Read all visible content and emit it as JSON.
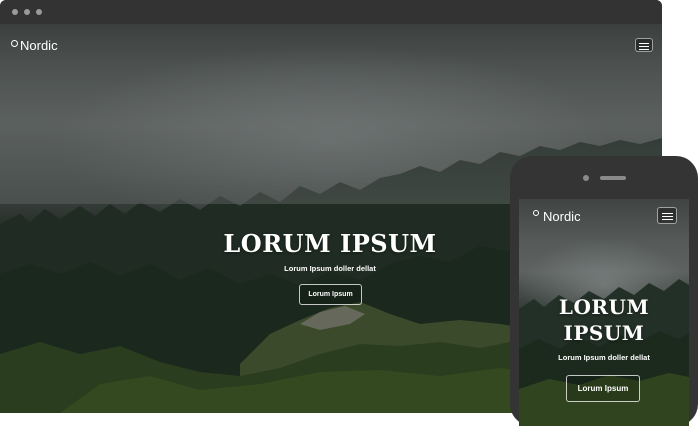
{
  "desktop": {
    "brand": "Nordic",
    "hero": {
      "title": "LORUM IPSUM",
      "subtitle": "Lorum Ipsum doller dellat",
      "button_label": "Lorum Ipsum"
    }
  },
  "mobile": {
    "brand": "Nordic",
    "hero": {
      "title_line1": "LORUM",
      "title_line2": "IPSUM",
      "subtitle": "Lorum Ipsum doller dellat",
      "button_label": "Lorum Ipsum"
    }
  },
  "icons": {
    "menu": "hamburger-menu-icon",
    "logo": "circle-logo-icon",
    "window_controls": "window-dot-icon"
  }
}
